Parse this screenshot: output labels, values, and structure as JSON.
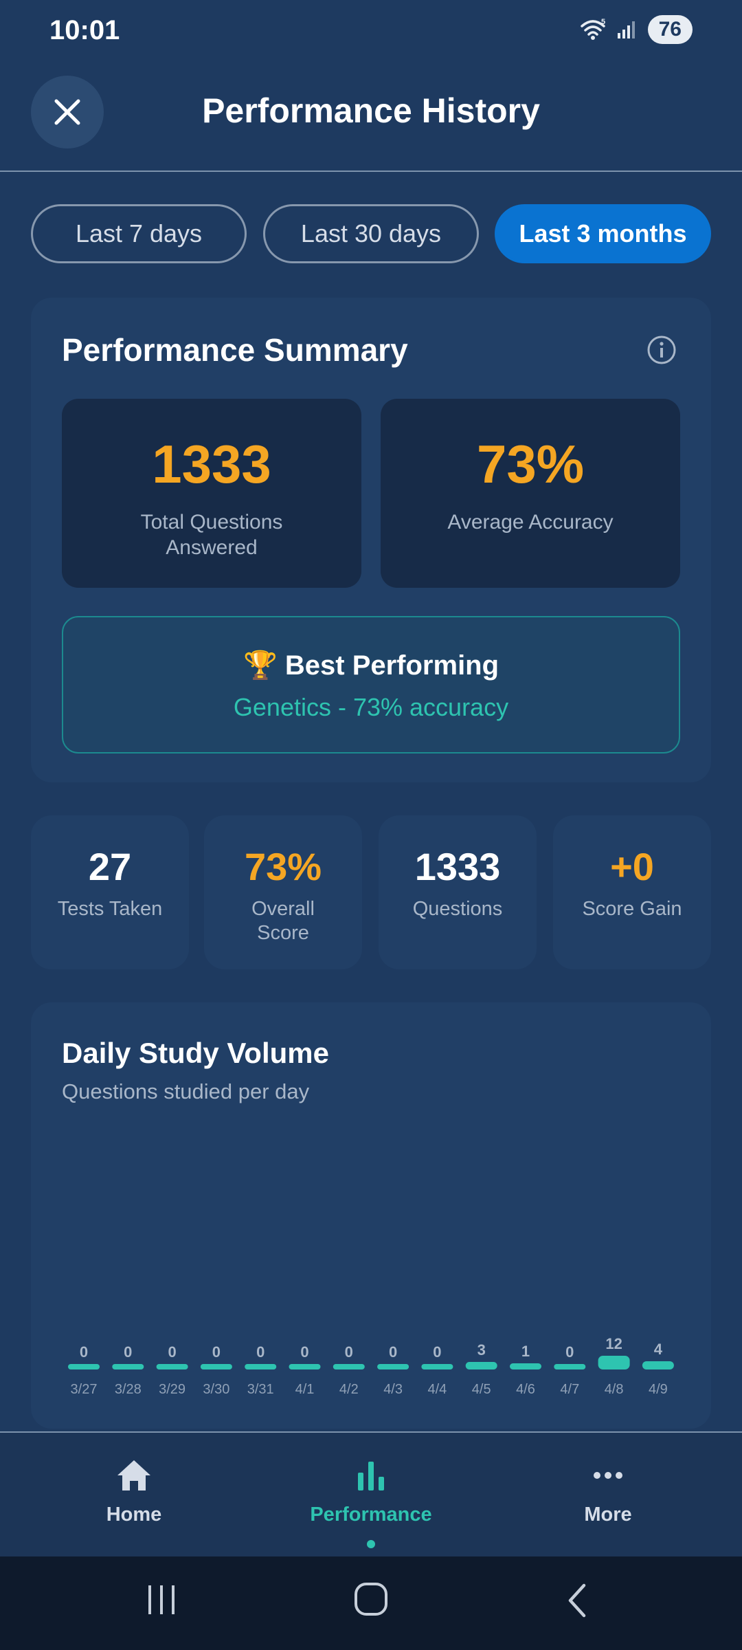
{
  "status_bar": {
    "time": "10:01",
    "battery": "76"
  },
  "header": {
    "title": "Performance History"
  },
  "tabs": [
    {
      "label": "Last 7 days",
      "active": false
    },
    {
      "label": "Last 30 days",
      "active": false
    },
    {
      "label": "Last 3 months",
      "active": true
    }
  ],
  "summary": {
    "title": "Performance Summary",
    "total_questions": {
      "value": "1333",
      "label_line1": "Total Questions",
      "label_line2": "Answered"
    },
    "average_accuracy": {
      "value": "73%",
      "label": "Average Accuracy"
    },
    "best_performing": {
      "emoji": "🏆",
      "title": "Best Performing",
      "detail": "Genetics - 73% accuracy"
    }
  },
  "mini_stats": [
    {
      "value": "27",
      "label_line1": "Tests Taken",
      "label_line2": "",
      "color": "#ffffff"
    },
    {
      "value": "73%",
      "label_line1": "Overall",
      "label_line2": "Score",
      "color": "#f5a623"
    },
    {
      "value": "1333",
      "label_line1": "Questions",
      "label_line2": "",
      "color": "#ffffff"
    },
    {
      "value": "+0",
      "label_line1": "Score Gain",
      "label_line2": "",
      "color": "#f5a623"
    }
  ],
  "chart": {
    "title": "Daily Study Volume",
    "subtitle": "Questions studied per day"
  },
  "chart_data": {
    "type": "bar",
    "categories": [
      "3/27",
      "3/28",
      "3/29",
      "3/30",
      "3/31",
      "4/1",
      "4/2",
      "4/3",
      "4/4",
      "4/5",
      "4/6",
      "4/7",
      "4/8",
      "4/9"
    ],
    "values": [
      0,
      0,
      0,
      0,
      0,
      0,
      0,
      0,
      0,
      3,
      1,
      0,
      12,
      4
    ],
    "title": "Daily Study Volume",
    "subtitle": "Questions studied per day",
    "color": "#2ec4b0",
    "grid": false
  },
  "bottom_nav": [
    {
      "label": "Home",
      "icon": "home-icon",
      "active": false
    },
    {
      "label": "Performance",
      "icon": "bar-chart-icon",
      "active": true
    },
    {
      "label": "More",
      "icon": "more-dots-icon",
      "active": false
    }
  ],
  "colors": {
    "accent": "#2ec4b0",
    "highlight": "#f5a623",
    "primary": "#0a73d1"
  }
}
